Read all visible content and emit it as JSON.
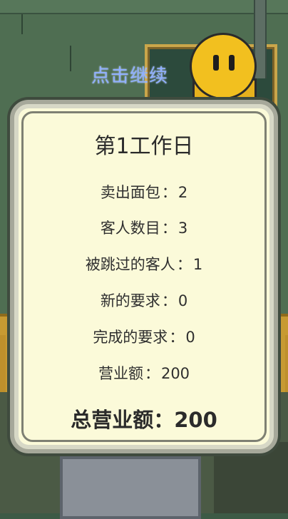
{
  "hud": {
    "continue_prompt": "点击继续"
  },
  "summary": {
    "title": "第1工作日",
    "separator": "：",
    "stats": [
      {
        "label": "卖出面包",
        "value": "2"
      },
      {
        "label": "客人数目",
        "value": "3"
      },
      {
        "label": "被跳过的客人",
        "value": "1"
      },
      {
        "label": "新的要求",
        "value": "0"
      },
      {
        "label": "完成的要求",
        "value": "0"
      },
      {
        "label": "营业额",
        "value": "200"
      }
    ],
    "total": {
      "label": "总营业额",
      "value": "200"
    }
  },
  "colors": {
    "panel_bg": "#fbfad9",
    "panel_border": "#a6a89a",
    "text": "#2b2b2b",
    "continue_text": "#8fb0ff",
    "character": "#f2c01f"
  }
}
